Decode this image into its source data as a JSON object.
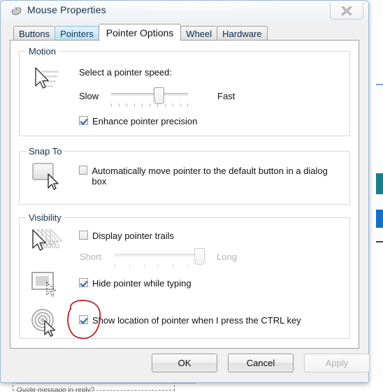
{
  "window": {
    "title": "Mouse Properties",
    "icon": "mouse-icon",
    "close_label": "X"
  },
  "tabs": [
    {
      "label": "Buttons",
      "state": "normal"
    },
    {
      "label": "Pointers",
      "state": "hover"
    },
    {
      "label": "Pointer Options",
      "state": "active"
    },
    {
      "label": "Wheel",
      "state": "normal"
    },
    {
      "label": "Hardware",
      "state": "normal"
    }
  ],
  "motion": {
    "group_title": "Motion",
    "icon": "pointer-speed-icon",
    "speed_label": "Select a pointer speed:",
    "slow_label": "Slow",
    "fast_label": "Fast",
    "slider_value_pct": 55,
    "slider_ticks": 11,
    "enhance_label": "Enhance pointer precision",
    "enhance_checked": true
  },
  "snap_to": {
    "group_title": "Snap To",
    "icon": "snap-to-button-icon",
    "auto_move_label": "Automatically move pointer to the default button in a dialog box",
    "auto_move_checked": false
  },
  "visibility": {
    "group_title": "Visibility",
    "trails_icon": "pointer-trails-icon",
    "trails_label": "Display pointer trails",
    "trails_checked": false,
    "short_label": "Short",
    "long_label": "Long",
    "trails_slider_value_pct": 88,
    "trails_slider_ticks": 7,
    "trails_slider_enabled": false,
    "hide_icon": "hide-pointer-typing-icon",
    "hide_label": "Hide pointer while typing",
    "hide_checked": true,
    "locate_icon": "locate-pointer-rings-icon",
    "locate_label": "Show location of pointer when I press the CTRL key",
    "locate_checked": true,
    "annotation": "red-circle-highlight"
  },
  "buttons": {
    "ok": "OK",
    "cancel": "Cancel",
    "apply": "Apply",
    "apply_enabled": false
  },
  "background": {
    "partial_text": "Quote message in reply?"
  },
  "colors": {
    "accent": "#2f66a8",
    "tab_hover": "#badef5",
    "annotation_red": "#c0161b",
    "title_text": "#16334d"
  }
}
